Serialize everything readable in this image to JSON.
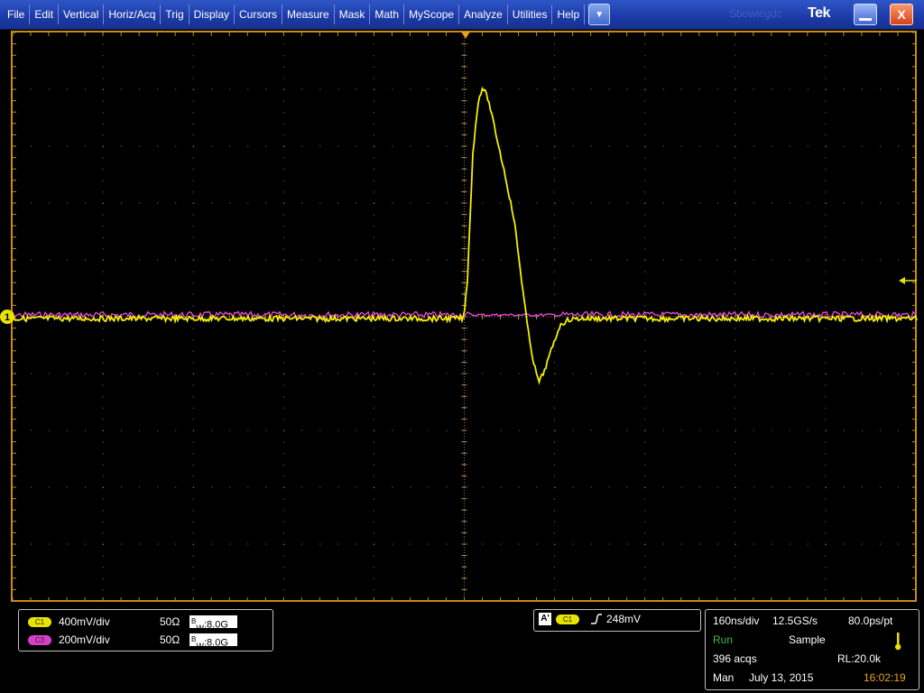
{
  "menu": {
    "items": [
      "File",
      "Edit",
      "Vertical",
      "Horiz/Acq",
      "Trig",
      "Display",
      "Cursors",
      "Measure",
      "Mask",
      "Math",
      "MyScope",
      "Analyze",
      "Utilities",
      "Help"
    ],
    "dropdown_glyph": "▼"
  },
  "title_bar": {
    "ghost_text": "Sbowlegdc",
    "brand": "Tek",
    "minimize_icon": "minimize-icon",
    "close_label": "X"
  },
  "channels": [
    {
      "id": "C1",
      "scale": "400mV/div",
      "impedance": "50Ω",
      "bw_super": "B",
      "bw_sub": "W",
      "bandwidth": ":8.0G",
      "color": "#e8e400"
    },
    {
      "id": "C3",
      "scale": "200mV/div",
      "impedance": "50Ω",
      "bw_super": "B",
      "bw_sub": "W",
      "bandwidth": ":8.0G",
      "color": "#d640c8"
    }
  ],
  "trigger": {
    "mode_label": "A'",
    "source": "C1",
    "slope_icon": "rising-edge-icon",
    "level": "248mV"
  },
  "acquisition": {
    "time_div": "160ns/div",
    "sample_rate": "12.5GS/s",
    "resolution": "80.0ps/pt",
    "state": "Run",
    "mode": "Sample",
    "acqs": "396 acqs",
    "record_length": "RL:20.0k",
    "trigger_mode": "Man",
    "date": "July 13, 2015",
    "time": "16:02:19"
  },
  "graticule": {
    "horizontal_divisions": 10,
    "vertical_divisions": 10,
    "ground_marker_label": "1",
    "color": "#c88a18"
  },
  "traces": {
    "c1_color": "#f5f000",
    "c3_color": "#e24ad6"
  }
}
